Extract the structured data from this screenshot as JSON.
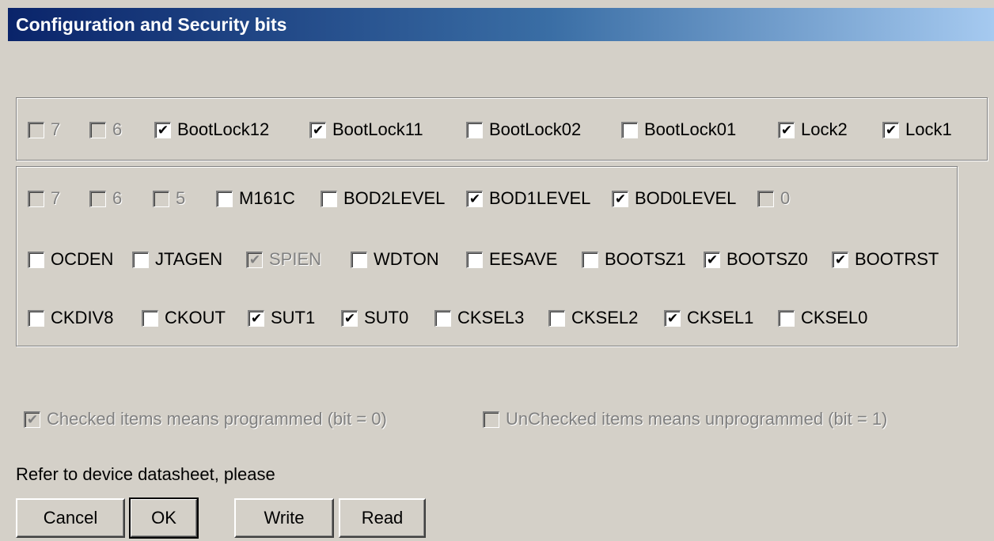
{
  "window": {
    "title": "Configuration and Security bits"
  },
  "lock_bits": [
    {
      "label": "7",
      "checked": false,
      "disabled": true
    },
    {
      "label": "6",
      "checked": false,
      "disabled": true
    },
    {
      "label": "BootLock12",
      "checked": true,
      "disabled": false
    },
    {
      "label": "BootLock11",
      "checked": true,
      "disabled": false
    },
    {
      "label": "BootLock02",
      "checked": false,
      "disabled": false
    },
    {
      "label": "BootLock01",
      "checked": false,
      "disabled": false
    },
    {
      "label": "Lock2",
      "checked": true,
      "disabled": false
    },
    {
      "label": "Lock1",
      "checked": true,
      "disabled": false
    }
  ],
  "fuse_rows": [
    [
      {
        "label": "7",
        "checked": false,
        "disabled": true
      },
      {
        "label": "6",
        "checked": false,
        "disabled": true
      },
      {
        "label": "5",
        "checked": false,
        "disabled": true
      },
      {
        "label": "M161C",
        "checked": false,
        "disabled": false
      },
      {
        "label": "BOD2LEVEL",
        "checked": false,
        "disabled": false
      },
      {
        "label": "BOD1LEVEL",
        "checked": true,
        "disabled": false
      },
      {
        "label": "BOD0LEVEL",
        "checked": true,
        "disabled": false
      },
      {
        "label": "0",
        "checked": false,
        "disabled": true
      }
    ],
    [
      {
        "label": "OCDEN",
        "checked": false,
        "disabled": false
      },
      {
        "label": "JTAGEN",
        "checked": false,
        "disabled": false
      },
      {
        "label": "SPIEN",
        "checked": true,
        "disabled": true
      },
      {
        "label": "WDTON",
        "checked": false,
        "disabled": false
      },
      {
        "label": "EESAVE",
        "checked": false,
        "disabled": false
      },
      {
        "label": "BOOTSZ1",
        "checked": false,
        "disabled": false
      },
      {
        "label": "BOOTSZ0",
        "checked": true,
        "disabled": false
      },
      {
        "label": "BOOTRST",
        "checked": true,
        "disabled": false
      }
    ],
    [
      {
        "label": "CKDIV8",
        "checked": false,
        "disabled": false
      },
      {
        "label": "CKOUT",
        "checked": false,
        "disabled": false
      },
      {
        "label": "SUT1",
        "checked": true,
        "disabled": false
      },
      {
        "label": "SUT0",
        "checked": true,
        "disabled": false
      },
      {
        "label": "CKSEL3",
        "checked": false,
        "disabled": false
      },
      {
        "label": "CKSEL2",
        "checked": false,
        "disabled": false
      },
      {
        "label": "CKSEL1",
        "checked": true,
        "disabled": false
      },
      {
        "label": "CKSEL0",
        "checked": false,
        "disabled": false
      }
    ]
  ],
  "legend": {
    "checked": {
      "label": "Checked items means programmed (bit = 0)",
      "checked": true
    },
    "unchecked": {
      "label": "UnChecked items means unprogrammed (bit = 1)",
      "checked": false
    }
  },
  "note": "Refer to device datasheet, please",
  "buttons": {
    "cancel": "Cancel",
    "ok": "OK",
    "write": "Write",
    "read": "Read"
  },
  "colors": {
    "dialog_bg": "#d4d0c8",
    "title_start": "#0a246a",
    "title_end": "#a6caf0",
    "disabled_text": "#808080"
  },
  "icons": {
    "check": "check-mark-icon"
  }
}
